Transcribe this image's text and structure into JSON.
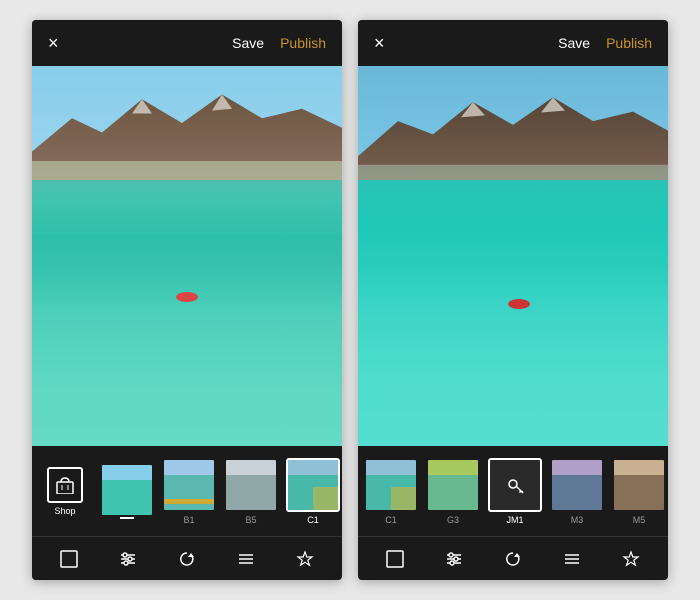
{
  "panels": [
    {
      "id": "left",
      "topBar": {
        "close": "×",
        "save": "Save",
        "publish": "Publish"
      },
      "toolbar": {
        "items": [
          "⊞",
          "⊜",
          "↺",
          "☰",
          "★"
        ]
      },
      "filters": {
        "shopLabel": "Shop",
        "items": [
          {
            "id": "default",
            "label": "",
            "selected": false
          },
          {
            "id": "b1",
            "label": "B1",
            "selected": false
          },
          {
            "id": "b5",
            "label": "B5",
            "selected": false
          },
          {
            "id": "c1",
            "label": "C1",
            "selected": true
          }
        ]
      }
    },
    {
      "id": "right",
      "topBar": {
        "close": "×",
        "save": "Save",
        "publish": "Publish"
      },
      "toolbar": {
        "items": [
          "⊞",
          "⊜",
          "↺",
          "☰",
          "★"
        ]
      },
      "filters": {
        "items": [
          {
            "id": "c1",
            "label": "C1",
            "selected": false
          },
          {
            "id": "g3",
            "label": "G3",
            "selected": false
          },
          {
            "id": "jm1",
            "label": "JM1",
            "selected": true
          },
          {
            "id": "m3",
            "label": "M3",
            "selected": false
          },
          {
            "id": "m5",
            "label": "M5",
            "selected": false
          }
        ]
      }
    }
  ],
  "colors": {
    "publishGold": "#c8922a",
    "white": "#ffffff",
    "dark": "#1a1a1a"
  }
}
